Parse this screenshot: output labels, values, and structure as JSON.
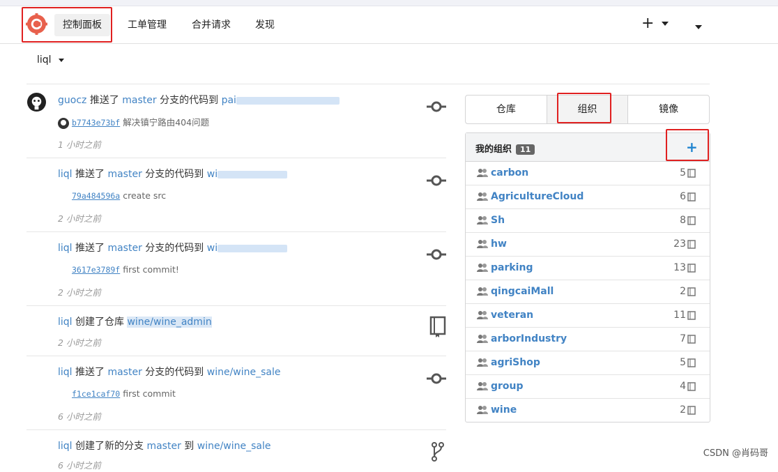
{
  "navbar": {
    "items": [
      "控制面板",
      "工单管理",
      "合并请求",
      "发现"
    ],
    "plus_label": "+"
  },
  "context": {
    "user": "liql"
  },
  "feed": [
    {
      "actor": "guocz",
      "action": "推送了",
      "branch": "master",
      "mid": "分支的代码到",
      "repo": "pai",
      "commit_sha": "b7743e73bf",
      "commit_msg": "解决镇宁路由404问题",
      "time": "1 小时之前",
      "icon": "commit-icon"
    },
    {
      "actor": "liql",
      "action": "推送了",
      "branch": "master",
      "mid": "分支的代码到",
      "repo": "wi",
      "commit_sha": "79a484596a",
      "commit_msg": "create src",
      "time": "2 小时之前",
      "icon": "commit-icon"
    },
    {
      "actor": "liql",
      "action": "推送了",
      "branch": "master",
      "mid": "分支的代码到",
      "repo": "wi",
      "commit_sha": "3617e3789f",
      "commit_msg": "first commit!",
      "time": "2 小时之前",
      "icon": "commit-icon"
    },
    {
      "actor": "liql",
      "action": "创建了仓库",
      "repo": "wine/wine_admin",
      "time": "2 小时之前",
      "icon": "book-icon"
    },
    {
      "actor": "liql",
      "action": "推送了",
      "branch": "master",
      "mid": "分支的代码到",
      "repo": "wine/wine_sale",
      "commit_sha": "f1ce1caf70",
      "commit_msg": "first commit",
      "time": "6 小时之前",
      "icon": "commit-icon"
    },
    {
      "actor": "liql",
      "action": "创建了新的分支",
      "branch": "master",
      "mid": "到",
      "repo": "wine/wine_sale",
      "time": "6 小时之前",
      "icon": "branch-icon"
    }
  ],
  "tabs": [
    "仓库",
    "组织",
    "镜像"
  ],
  "orgs": {
    "title": "我的组织",
    "count": "11",
    "add_label": "+",
    "items": [
      {
        "name": "carbon",
        "repos": "5"
      },
      {
        "name": "AgricultureCloud",
        "repos": "6"
      },
      {
        "name": "Sh",
        "repos": "8"
      },
      {
        "name": "hw",
        "repos": "23"
      },
      {
        "name": "parking",
        "repos": "13"
      },
      {
        "name": "qingcaiMall",
        "repos": "2"
      },
      {
        "name": "veteran",
        "repos": "11"
      },
      {
        "name": "arborIndustry",
        "repos": "7"
      },
      {
        "name": "agriShop",
        "repos": "5"
      },
      {
        "name": "group",
        "repos": "4"
      },
      {
        "name": "wine",
        "repos": "2"
      }
    ]
  },
  "watermark": "CSDN @肖码哥"
}
